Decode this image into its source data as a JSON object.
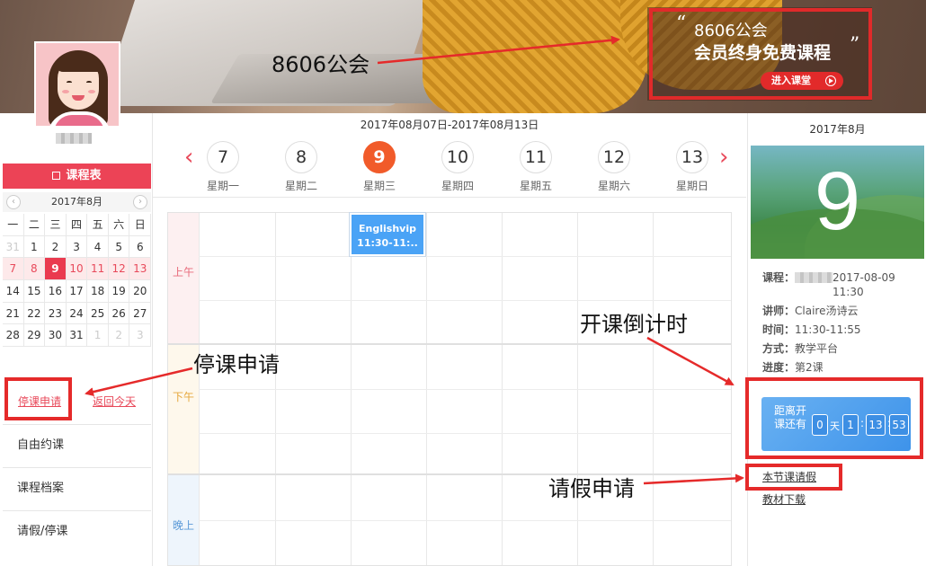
{
  "banner": {
    "ad_line1": "8606公会",
    "ad_line2": "会员终身免费课程",
    "ad_button": "进入课堂",
    "quote_open": "“",
    "quote_close": "”"
  },
  "sidebar": {
    "schedule_title": "课程表",
    "mini_calendar": {
      "month": "2017年8月",
      "prev": "‹",
      "next": "›",
      "weekdays": [
        "一",
        "二",
        "三",
        "四",
        "五",
        "六",
        "日"
      ],
      "weeks": [
        [
          {
            "d": "31",
            "s": "grey"
          },
          {
            "d": "1",
            "s": "plain"
          },
          {
            "d": "2",
            "s": "plain"
          },
          {
            "d": "3",
            "s": "plain"
          },
          {
            "d": "4",
            "s": "plain"
          },
          {
            "d": "5",
            "s": "plain"
          },
          {
            "d": "6",
            "s": "plain"
          }
        ],
        [
          {
            "d": "7",
            "s": "pink"
          },
          {
            "d": "8",
            "s": "pink"
          },
          {
            "d": "9",
            "s": "sel"
          },
          {
            "d": "10",
            "s": "pink"
          },
          {
            "d": "11",
            "s": "pink"
          },
          {
            "d": "12",
            "s": "pink"
          },
          {
            "d": "13",
            "s": "pink"
          }
        ],
        [
          {
            "d": "14",
            "s": "plain"
          },
          {
            "d": "15",
            "s": "plain"
          },
          {
            "d": "16",
            "s": "plain"
          },
          {
            "d": "17",
            "s": "plain"
          },
          {
            "d": "18",
            "s": "plain"
          },
          {
            "d": "19",
            "s": "plain"
          },
          {
            "d": "20",
            "s": "plain"
          }
        ],
        [
          {
            "d": "21",
            "s": "plain"
          },
          {
            "d": "22",
            "s": "plain"
          },
          {
            "d": "23",
            "s": "plain"
          },
          {
            "d": "24",
            "s": "plain"
          },
          {
            "d": "25",
            "s": "plain"
          },
          {
            "d": "26",
            "s": "plain"
          },
          {
            "d": "27",
            "s": "plain"
          }
        ],
        [
          {
            "d": "28",
            "s": "plain"
          },
          {
            "d": "29",
            "s": "plain"
          },
          {
            "d": "30",
            "s": "plain"
          },
          {
            "d": "31",
            "s": "plain"
          },
          {
            "d": "1",
            "s": "grey"
          },
          {
            "d": "2",
            "s": "grey"
          },
          {
            "d": "3",
            "s": "grey"
          }
        ]
      ]
    },
    "stop_class_link": "停课申请",
    "back_today_link": "返回今天",
    "menu": [
      "自由约课",
      "课程档案",
      "请假/停课"
    ]
  },
  "week": {
    "range": "2017年08月07日-2017年08月13日",
    "days": [
      {
        "num": "7",
        "label": "星期一",
        "active": false
      },
      {
        "num": "8",
        "label": "星期二",
        "active": false
      },
      {
        "num": "9",
        "label": "星期三",
        "active": true
      },
      {
        "num": "10",
        "label": "星期四",
        "active": false
      },
      {
        "num": "11",
        "label": "星期五",
        "active": false
      },
      {
        "num": "12",
        "label": "星期六",
        "active": false
      },
      {
        "num": "13",
        "label": "星期日",
        "active": false
      }
    ],
    "prev_arrow": "‹",
    "next_arrow": "›"
  },
  "timetable": {
    "periods": {
      "am": "上午",
      "pm": "下午",
      "evening": "晚上"
    },
    "lesson": {
      "line1": "Englishvip",
      "line2": "11:30-11:.."
    }
  },
  "right": {
    "month": "2017年8月",
    "day": "9",
    "course_label": "课程：",
    "course_value": "2017-08-09 11:30",
    "teacher_label": "讲师：",
    "teacher_value": "Claire汤诗云",
    "time_label": "时间：",
    "time_value": "11:30-11:55",
    "method_label": "方式：",
    "method_value": "教学平台",
    "progress_label": "进度：",
    "progress_value": "第2课",
    "countdown": {
      "label": "距离开课还有",
      "days": "0",
      "day_unit": "天",
      "hours": "1",
      "minutes": "13",
      "seconds": "53",
      "sep": ":"
    },
    "leave_link": "本节课请假",
    "download_link": "教材下载"
  },
  "annotations": {
    "guild": "8606公会",
    "stop_request": "停课申请",
    "countdown": "开课倒计时",
    "leave_request": "请假申请"
  },
  "colors": {
    "accent": "#ea3a4f",
    "annotation": "#e52a2a",
    "lesson_blue": "#4aa3f6",
    "active_day": "#f15b2a"
  }
}
